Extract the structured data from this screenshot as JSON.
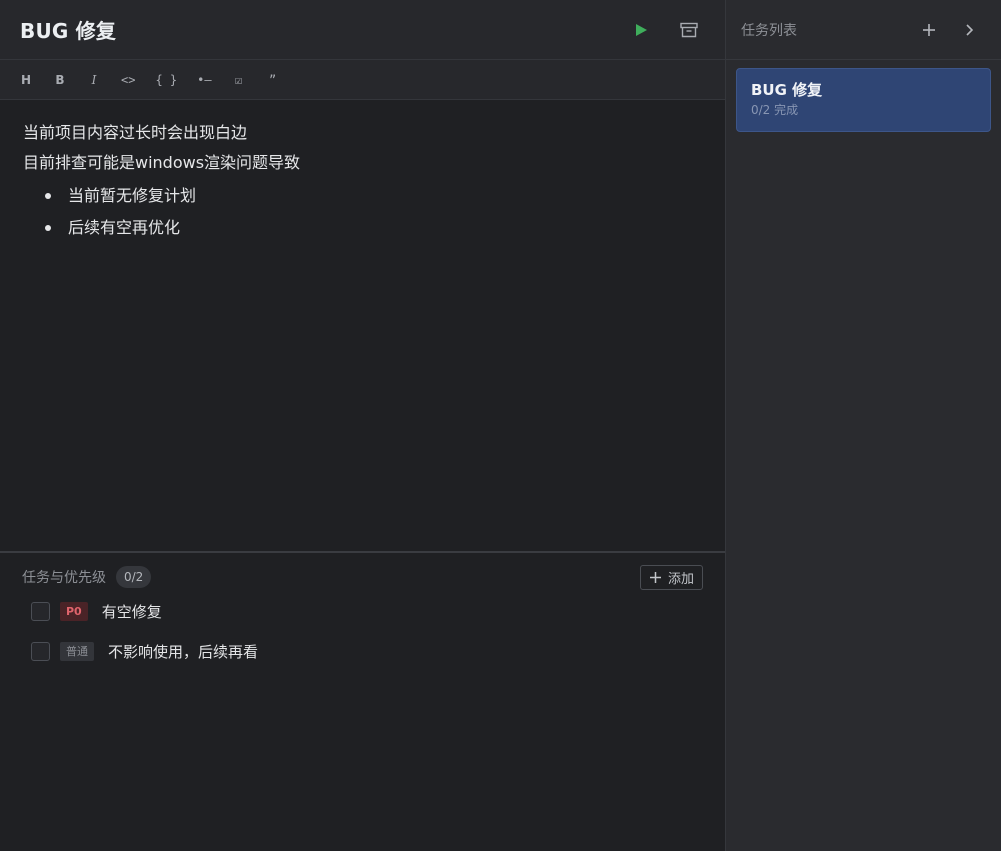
{
  "editor": {
    "title": "BUG 修复",
    "actions": {
      "run_icon": "play-icon",
      "archive_icon": "archive-icon"
    },
    "toolbar": {
      "heading": "H",
      "bold": "B",
      "italic": "I",
      "code": "<>",
      "code_block": "{ }",
      "bullet_list": "•—",
      "checklist": "☑",
      "quote": "”"
    },
    "content": {
      "lines": [
        "当前项目内容过长时会出现白边",
        "目前排查可能是windows渲染问题导致"
      ],
      "bullets": [
        "当前暂无修复计划",
        "后续有空再优化"
      ]
    }
  },
  "tasks": {
    "title": "任务与优先级",
    "count": "0/2",
    "add_label": "添加",
    "items": [
      {
        "priority": "P0",
        "label": "有空修复",
        "checked": false
      },
      {
        "priority": "普通",
        "label": "不影响使用，后续再看",
        "checked": false
      }
    ]
  },
  "sidebar": {
    "title": "任务列表",
    "card": {
      "title": "BUG 修复",
      "subtitle": "0/2 完成"
    }
  },
  "colors": {
    "accent_green": "#3fae5c",
    "card_blue": "#2f4574",
    "p0_red": "#e0646c"
  }
}
